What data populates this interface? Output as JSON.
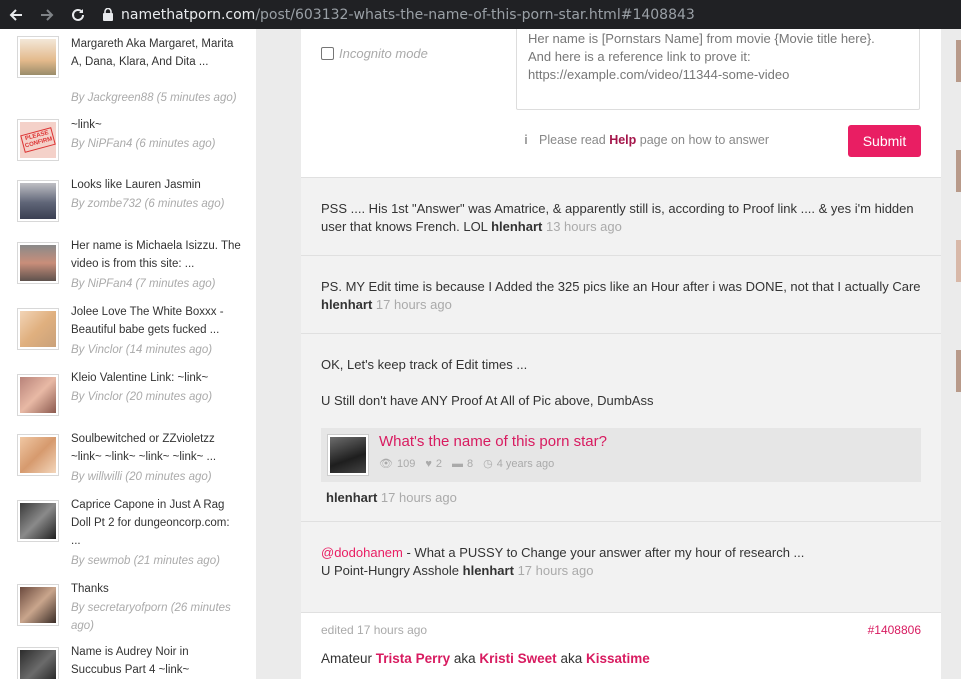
{
  "browser": {
    "url_host": "namethatporn.com",
    "url_path": "/post/603132-whats-the-name-of-this-porn-star.html#1408843"
  },
  "sidebar": {
    "items": [
      {
        "text": "Margareth Aka Margaret, Marita A, Dana, Klara, And Dita ...",
        "by": "By Jackgreen88 (5 minutes ago)"
      },
      {
        "text": "~link~",
        "by": "By NiPFan4 (6 minutes ago)"
      },
      {
        "text": "Looks like Lauren Jasmin",
        "by": "By zombe732 (6 minutes ago)"
      },
      {
        "text": "Her name is Michaela Isizzu. The video is from this site: ...",
        "by": "By NiPFan4 (7 minutes ago)"
      },
      {
        "text": "Jolee Love The White Boxxx - Beautiful babe gets fucked ...",
        "by": "By Vinclor (14 minutes ago)"
      },
      {
        "text": "Kleio Valentine Link: ~link~",
        "by": "By Vinclor (20 minutes ago)"
      },
      {
        "text": "Soulbewitched or ZZvioletzz ~link~ ~link~ ~link~ ~link~ ...",
        "by": "By willwilli (20 minutes ago)"
      },
      {
        "text": "Caprice Capone in Just A Rag Doll Pt 2 for dungeoncorp.com: ...",
        "by": "By sewmob (21 minutes ago)"
      },
      {
        "text": "Thanks",
        "by": "By secretaryofporn (26 minutes ago)"
      },
      {
        "text": "Name is Audrey Noir in Succubus Part 4 ~link~",
        "by": ""
      }
    ],
    "thumb_labels": {
      "please_confirm": "PLEASE CONFIRM"
    }
  },
  "form": {
    "incognito_label": "Incognito mode",
    "textarea_value": "Her name is [Pornstars Name] from movie {Movie title here}.\nAnd here is a reference link to prove it:\nhttps://example.com/video/11344-some-video",
    "help_prefix": "Please read",
    "help_link": "Help",
    "help_suffix": "page on how to answer",
    "submit_label": "Submit"
  },
  "comments": [
    {
      "text": "PSS .... His 1st \"Answer\" was Amatrice, & apparently still is, according to Proof link .... & yes i'm hidden user that knows French. LOL",
      "author": "hlenhart",
      "time": "13 hours ago"
    },
    {
      "text": "PS. MY Edit time is because I Added the 325 pics like an Hour after i was DONE, not that I actually Care",
      "author": "hlenhart",
      "time": "17 hours ago"
    },
    {
      "line1": "OK, Let's keep track of Edit times ...",
      "line2": "U Still don't have ANY Proof At All of Pic above, DumbAss",
      "author": "hlenhart",
      "time": "17 hours ago",
      "embed": {
        "title": "What's the name of this porn star?",
        "views": "109",
        "likes": "2",
        "comments": "8",
        "age": "4 years ago"
      }
    },
    {
      "mention": "@dodohanem",
      "text": " - What a PUSSY to Change your answer after my hour of research ...",
      "line2": "U Point-Hungry Asshole",
      "author": "hlenhart",
      "time": "17 hours ago"
    }
  ],
  "answer": {
    "edited": "edited 17 hours ago",
    "anchor": "#1408806",
    "prefix": "Amateur",
    "name1": "Trista Perry",
    "aka1": "aka",
    "name2": "Kristi Sweet",
    "aka2": "aka",
    "name3": "Kissatime"
  },
  "colors": {
    "accent": "#e91e63",
    "chrome": "#202124"
  }
}
